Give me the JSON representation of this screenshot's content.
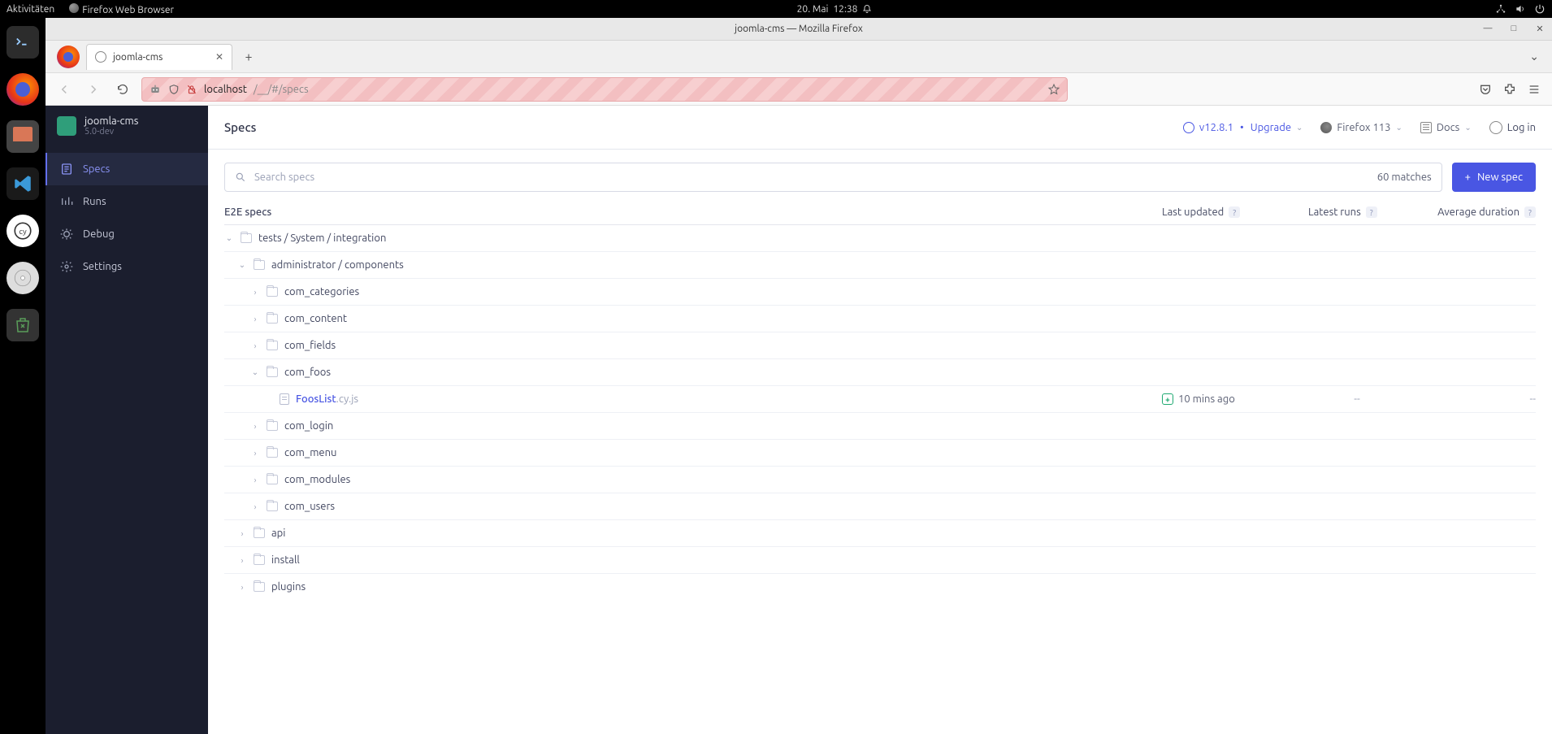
{
  "gnome": {
    "activities": "Aktivitäten",
    "app": "Firefox Web Browser",
    "date": "20. Mai",
    "time": "12:38"
  },
  "firefox": {
    "window_title": "joomla-cms — Mozilla Firefox",
    "tab_title": "joomla-cms",
    "url_host": "localhost",
    "url_path": "/__/#/specs"
  },
  "project": {
    "name": "joomla-cms",
    "version": "5.0-dev"
  },
  "nav": {
    "specs": "Specs",
    "runs": "Runs",
    "debug": "Debug",
    "settings": "Settings"
  },
  "header": {
    "title": "Specs",
    "version": "v12.8.1",
    "upgrade": "Upgrade",
    "browser": "Firefox 113",
    "docs": "Docs",
    "login": "Log in"
  },
  "search": {
    "placeholder": "Search specs",
    "matches": "60 matches"
  },
  "newspec": "New spec",
  "columns": {
    "c1": "E2E specs",
    "c2": "Last updated",
    "c3": "Latest runs",
    "c4": "Average duration"
  },
  "tree": {
    "root": "tests / System / integration",
    "admin": "administrator / components",
    "com_categories": "com_categories",
    "com_content": "com_content",
    "com_fields": "com_fields",
    "com_foos": "com_foos",
    "foos_name": "FoosList",
    "foos_ext": ".cy.js",
    "foos_time": "10 mins ago",
    "dash": "--",
    "com_login": "com_login",
    "com_menu": "com_menu",
    "com_modules": "com_modules",
    "com_users": "com_users",
    "api": "api",
    "install": "install",
    "plugins": "plugins"
  }
}
